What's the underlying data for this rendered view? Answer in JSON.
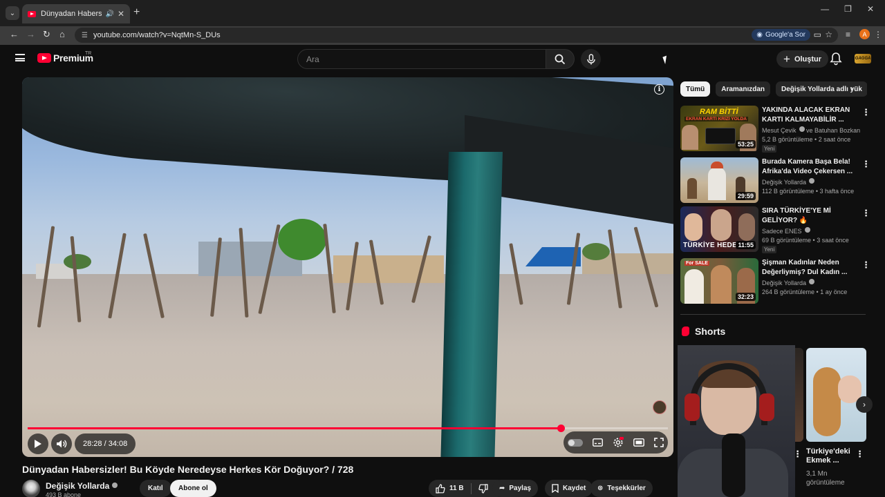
{
  "browser": {
    "tab_title": "Dünyadan Habersizler! Bu K",
    "url": "youtube.com/watch?v=NqtMn-S_DUs",
    "google_sor": "Google'a Sor",
    "profile_initial": "A"
  },
  "header": {
    "logo_text": "Premium",
    "logo_region": "TR",
    "search_placeholder": "Ara",
    "create_label": "Oluştur",
    "account_logo": "GAGGA"
  },
  "player": {
    "time_display": "28:28 / 34:08",
    "progress": 0.833
  },
  "video": {
    "title": "Dünyadan Habersizler! Bu Köyde Neredeyse Herkes Kör Doğuyor? / 728",
    "channel_name": "Değişik Yollarda",
    "subscribers": "493 B abone",
    "join_label": "Katıl",
    "subscribe_label": "Abone ol",
    "likes": "11 B",
    "share_label": "Paylaş",
    "save_label": "Kaydet",
    "thanks_label": "Teşekkürler"
  },
  "chips": [
    "Tümü",
    "Aramanızdan",
    "Değişik Yollarda adlı yük"
  ],
  "recommendations": [
    {
      "title": "YAKINDA ALACAK EKRAN KARTI KALMAYABİLİR ...",
      "channel": "Mesut Çevik",
      "channel_extra": "ve Batuhan Bozkan",
      "meta": "5,2 B görüntüleme • 2 saat önce",
      "badge": "Yeni",
      "duration": "53:25",
      "thumb_text_1": "RAM BİTTİ",
      "thumb_text_2": "EKRAN KARTI KRİZİ YOLDA"
    },
    {
      "title": "Burada Kamera Başa Bela! Afrika'da Video Çekersen ...",
      "channel": "Değişik Yollarda",
      "meta": "112 B görüntüleme • 3 hafta önce",
      "duration": "29:59"
    },
    {
      "title": "SIRA TÜRKİYE'YE Mİ GELİYOR? 🔥",
      "channel": "Sadece ENES",
      "meta": "69 B görüntüleme • 3 saat önce",
      "badge": "Yeni",
      "duration": "11:55",
      "thumb_text_1": "TÜRKİYE HEDE"
    },
    {
      "title": "Şişman Kadınlar Neden Değerliymiş? Dul Kadın ...",
      "channel": "Değişik Yollarda",
      "meta": "264 B görüntüleme • 1 ay önce",
      "duration": "32:23",
      "thumb_text_1": "For SALE"
    }
  ],
  "shorts": {
    "heading": "Shorts",
    "items": [
      {
        "title_1": "Türkiye'deki",
        "title_2": "Ekmek ...",
        "views_1": "3,1 Mn",
        "views_2": "görüntüleme"
      }
    ]
  },
  "colors": {
    "background": "#0f0f0f",
    "accent_red": "#ff0033",
    "chip_bg": "#272727"
  }
}
